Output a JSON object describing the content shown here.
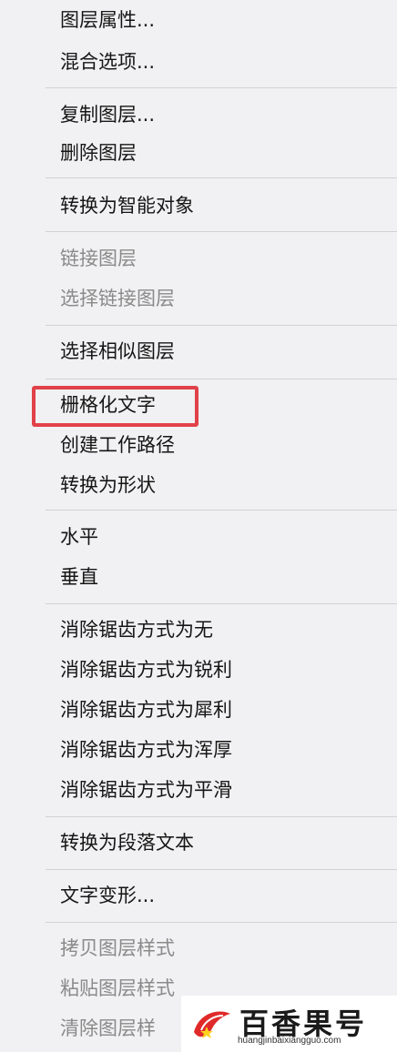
{
  "menu": {
    "items": [
      {
        "label": "图层属性...",
        "enabled": true
      },
      {
        "label": "混合选项...",
        "enabled": true
      },
      {
        "label": "复制图层...",
        "enabled": true
      },
      {
        "label": "删除图层",
        "enabled": true
      },
      {
        "label": "转换为智能对象",
        "enabled": true
      },
      {
        "label": "链接图层",
        "enabled": false
      },
      {
        "label": "选择链接图层",
        "enabled": false
      },
      {
        "label": "选择相似图层",
        "enabled": true
      },
      {
        "label": "栅格化文字",
        "enabled": true,
        "highlighted": true
      },
      {
        "label": "创建工作路径",
        "enabled": true
      },
      {
        "label": "转换为形状",
        "enabled": true
      },
      {
        "label": "水平",
        "enabled": true
      },
      {
        "label": "垂直",
        "enabled": true
      },
      {
        "label": "消除锯齿方式为无",
        "enabled": true
      },
      {
        "label": "消除锯齿方式为锐利",
        "enabled": true
      },
      {
        "label": "消除锯齿方式为犀利",
        "enabled": true
      },
      {
        "label": "消除锯齿方式为浑厚",
        "enabled": true
      },
      {
        "label": "消除锯齿方式为平滑",
        "enabled": true
      },
      {
        "label": "转换为段落文本",
        "enabled": true
      },
      {
        "label": "文字变形...",
        "enabled": true
      },
      {
        "label": "拷贝图层样式",
        "enabled": false
      },
      {
        "label": "粘贴图层样式",
        "enabled": false
      },
      {
        "label": "清除图层样",
        "enabled": false
      }
    ],
    "highlight_color": "#e14148"
  },
  "watermark": {
    "brand": "百香果号",
    "url": "huangjinbaixiangguo.com"
  }
}
